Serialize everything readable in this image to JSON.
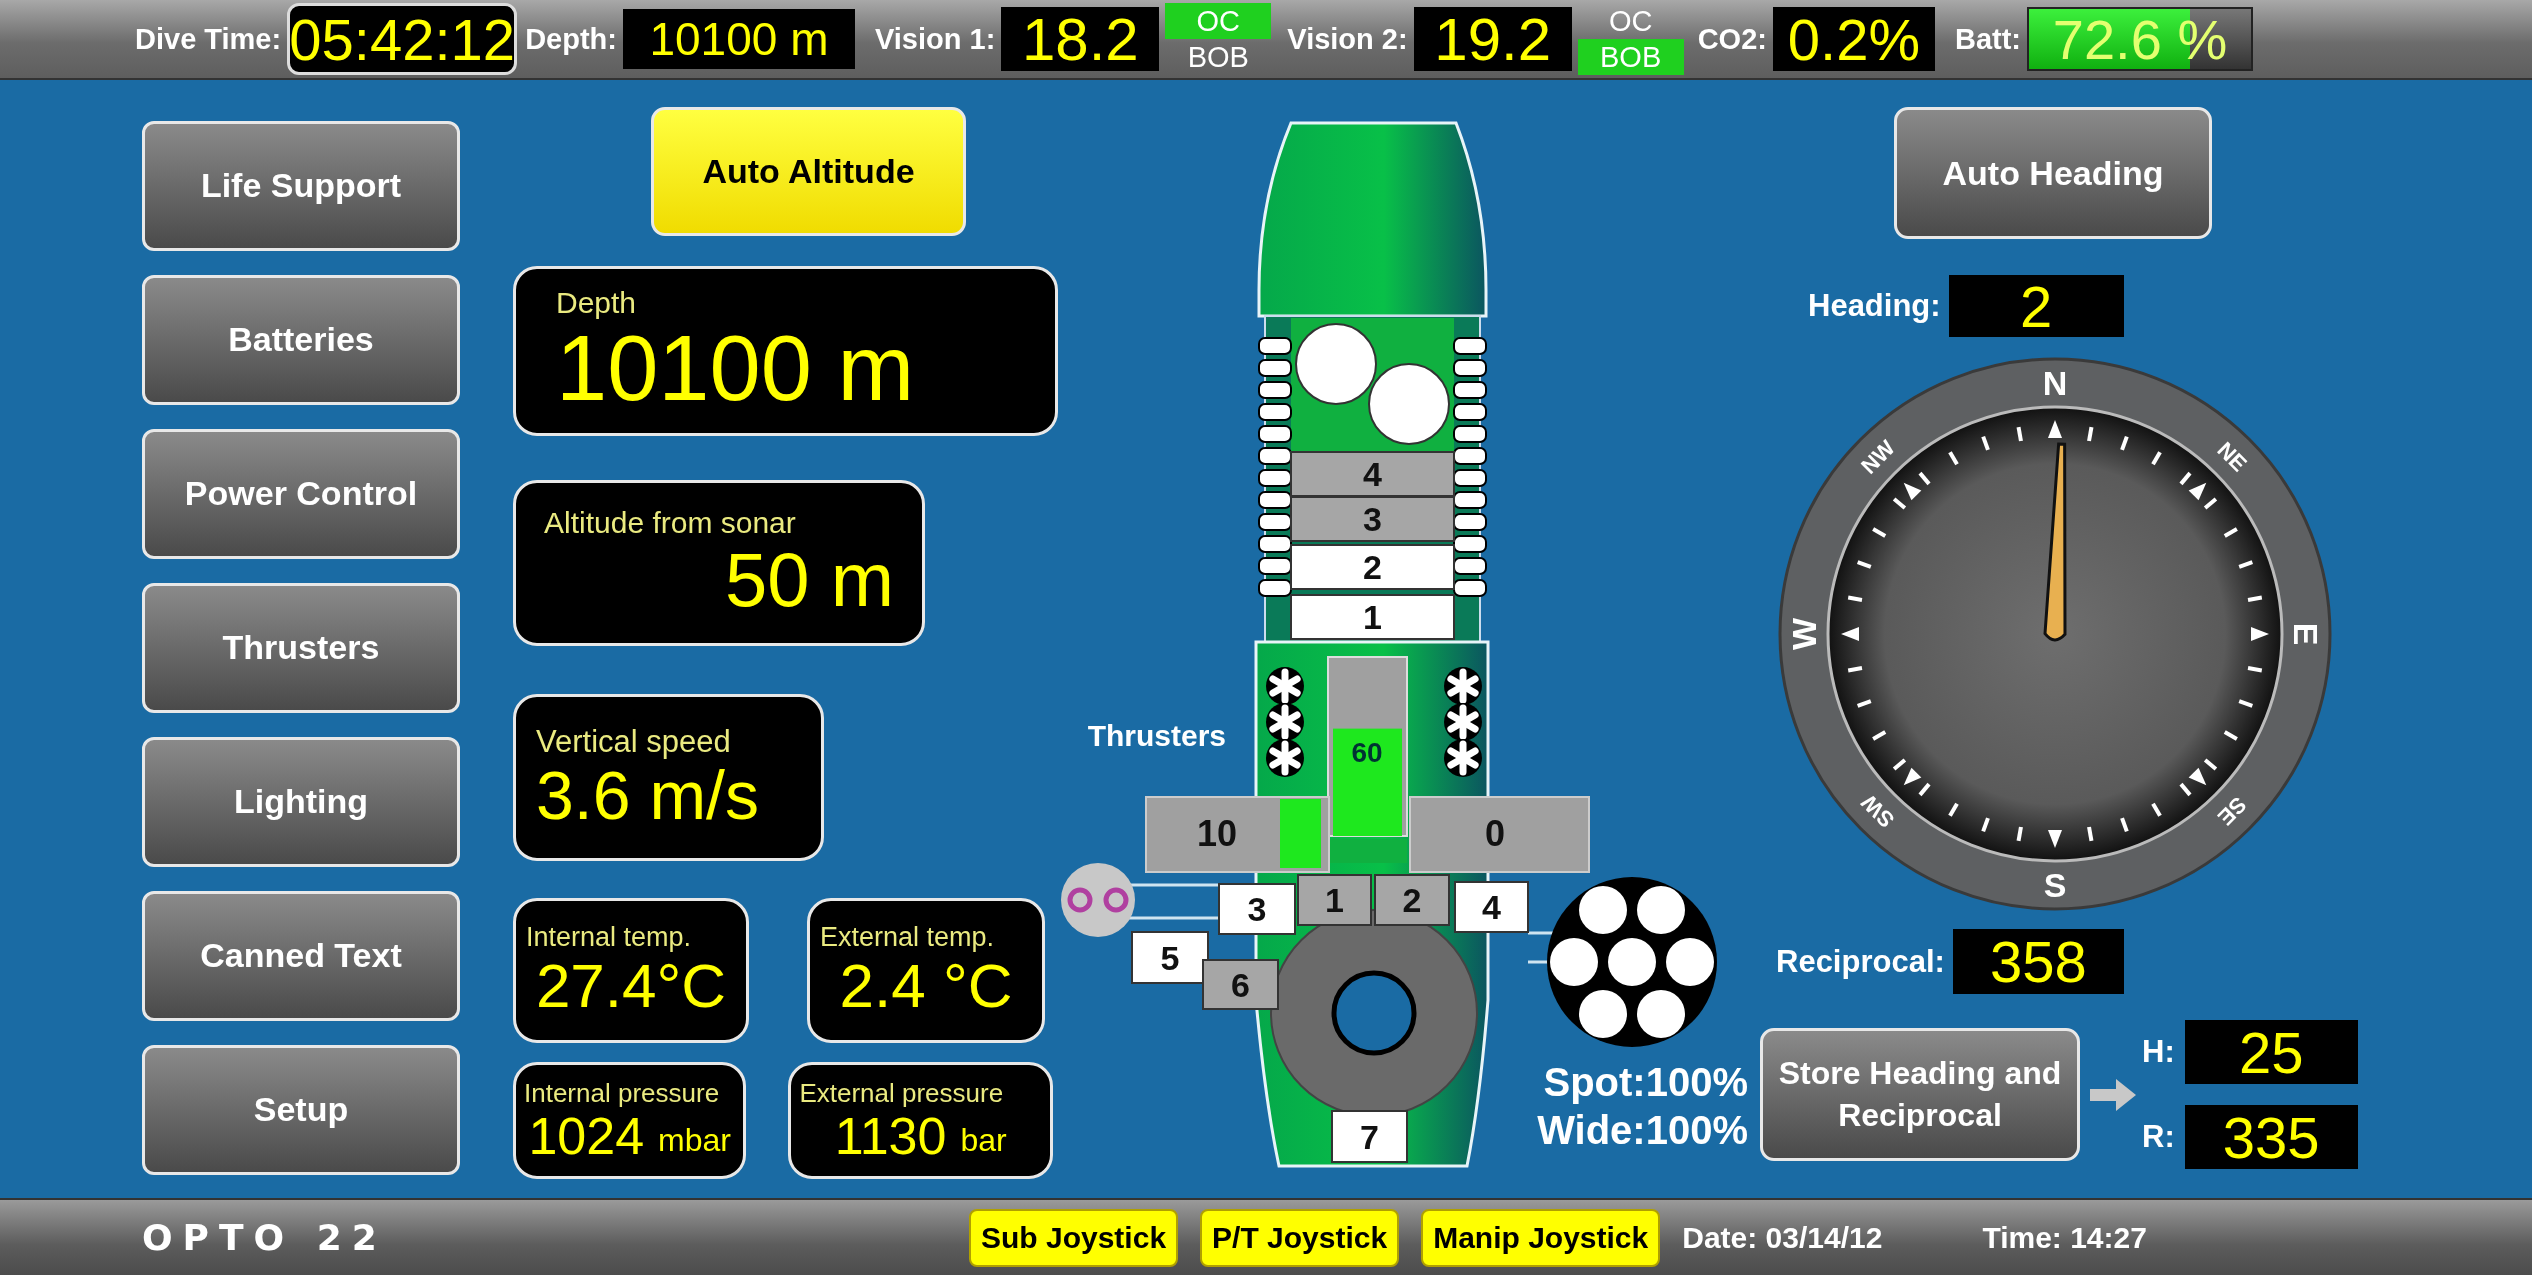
{
  "top_bar": {
    "dive_time": {
      "label": "Dive Time:",
      "value": "05:42:12"
    },
    "depth": {
      "label": "Depth:",
      "value": "10100 m"
    },
    "vision": [
      {
        "label": "Vision 1:",
        "value": "18.2",
        "modes": [
          {
            "label": "OC",
            "selected": true
          },
          {
            "label": "BOB",
            "selected": false
          }
        ]
      },
      {
        "label": "Vision 2:",
        "value": "19.2",
        "modes": [
          {
            "label": "OC",
            "selected": false
          },
          {
            "label": "BOB",
            "selected": true
          }
        ]
      }
    ],
    "co2": {
      "label": "CO2:",
      "value": "0.2%"
    },
    "battery": {
      "label": "Batt:",
      "value": "72.6 %",
      "level": 0.726
    }
  },
  "nav_buttons": [
    "Life Support",
    "Batteries",
    "Power Control",
    "Thrusters",
    "Lighting",
    "Canned Text",
    "Setup"
  ],
  "auto_altitude": {
    "label": "Auto Altitude",
    "active": true
  },
  "depth_readout": {
    "label": "Depth",
    "value": "10100 m"
  },
  "altitude_readout": {
    "label": "Altitude from sonar",
    "value": "50 m"
  },
  "vertical_speed": {
    "label": "Vertical speed",
    "value": "3.6 m/s"
  },
  "temperatures": [
    {
      "label": "Internal temp.",
      "value": "27.4°C"
    },
    {
      "label": "External temp.",
      "value": "2.4 °C"
    }
  ],
  "pressures": [
    {
      "label": "Internal pressure",
      "value": "1024",
      "unit": "mbar"
    },
    {
      "label": "External pressure",
      "value": "1130",
      "unit": "bar"
    }
  ],
  "sub_diagram": {
    "battery_modules": [
      {
        "label": "4",
        "on": false
      },
      {
        "label": "3",
        "on": false
      },
      {
        "label": "2",
        "on": true
      },
      {
        "label": "1",
        "on": true
      }
    ],
    "thrusters_label": "Thrusters",
    "vertical_thrust": {
      "value": "60",
      "level": 0.6
    },
    "lateral_thrust": [
      "10",
      "0"
    ],
    "thrusters": [
      {
        "label": "3",
        "on": true
      },
      {
        "label": "1",
        "on": false
      },
      {
        "label": "2",
        "on": false
      },
      {
        "label": "4",
        "on": true
      },
      {
        "label": "5",
        "on": true
      },
      {
        "label": "6",
        "on": false
      },
      {
        "label": "7",
        "on": true
      }
    ],
    "lights": [
      "Spot:100%",
      "Wide:100%"
    ]
  },
  "auto_heading": {
    "label": "Auto Heading",
    "active": false
  },
  "heading": {
    "label": "Heading:",
    "value": "2"
  },
  "compass_labels": [
    "N",
    "NE",
    "E",
    "SE",
    "S",
    "SW",
    "W",
    "NW"
  ],
  "reciprocal": {
    "label": "Reciprocal:",
    "value": "358"
  },
  "store_button": "Store Heading and Reciprocal",
  "stored": [
    {
      "label": "H:",
      "value": "25"
    },
    {
      "label": "R:",
      "value": "335"
    }
  ],
  "bottom_bar": {
    "logo": "OPTO 22",
    "joysticks": [
      {
        "label": "Sub Joystick",
        "active": true
      },
      {
        "label": "P/T Joystick",
        "active": true
      },
      {
        "label": "Manip Joystick",
        "active": true
      }
    ],
    "date": "Date: 03/14/12",
    "time": "Time: 14:27"
  }
}
